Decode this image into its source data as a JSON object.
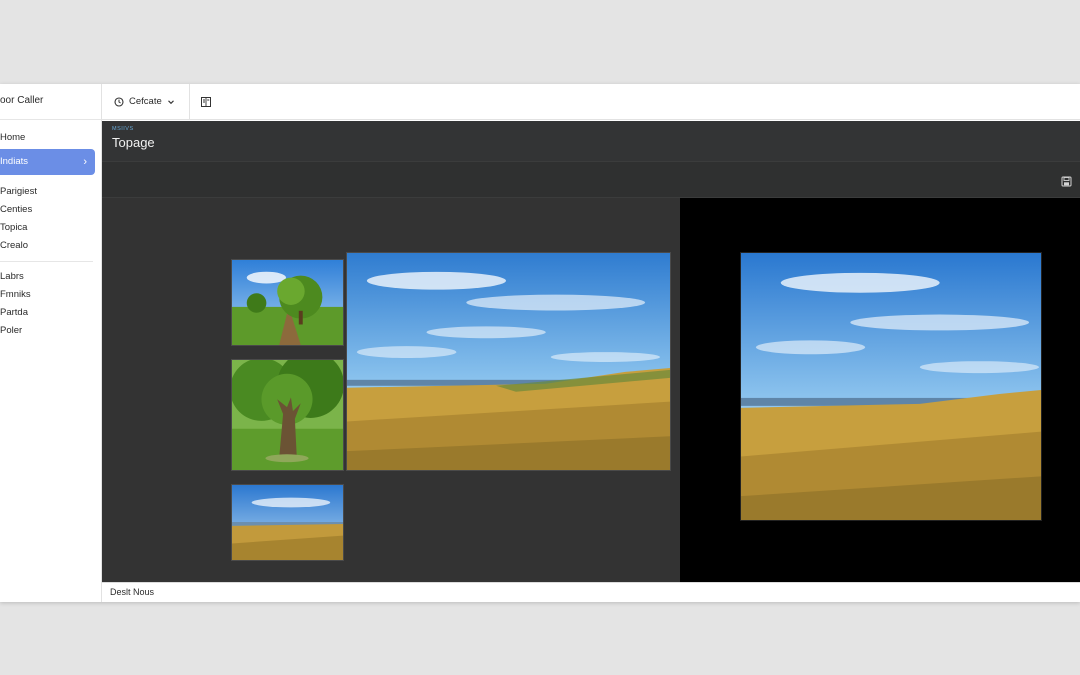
{
  "app": {
    "title": "oor Caller"
  },
  "sidebar": {
    "items": [
      {
        "label": "Home",
        "active": false
      },
      {
        "label": "Indiats",
        "active": true
      },
      {
        "label": "Parigiest",
        "active": false
      },
      {
        "label": "Centies",
        "active": false
      },
      {
        "label": "Topica",
        "active": false
      },
      {
        "label": "Crealo",
        "active": false
      },
      {
        "label": "Labrs",
        "active": false
      },
      {
        "label": "Fmniks",
        "active": false
      },
      {
        "label": "Partda",
        "active": false
      },
      {
        "label": "Poler",
        "active": false
      }
    ]
  },
  "toolbar": {
    "dropdown_label": "Cefcate"
  },
  "header": {
    "breadcrumb": "MSIIVS",
    "title": "Topage"
  },
  "gallery": {
    "thumbnails": [
      "tree-path",
      "oak-tree",
      "field-sky"
    ],
    "main": "field-landscape",
    "preview": "field-landscape"
  },
  "status": {
    "text": "Deslt Nous"
  },
  "colors": {
    "accent": "#6b8ee6",
    "dark_bg": "#333333",
    "preview_bg": "#000000",
    "breadcrumb": "#69a9d6"
  }
}
